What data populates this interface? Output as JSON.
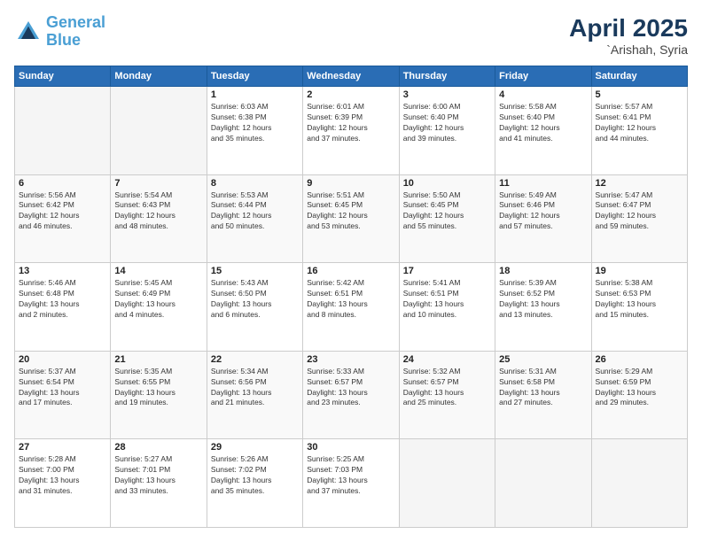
{
  "header": {
    "logo_line1": "General",
    "logo_line2": "Blue",
    "month_year": "April 2025",
    "location": "`Arishah, Syria"
  },
  "days_of_week": [
    "Sunday",
    "Monday",
    "Tuesday",
    "Wednesday",
    "Thursday",
    "Friday",
    "Saturday"
  ],
  "weeks": [
    [
      {
        "day": "",
        "info": ""
      },
      {
        "day": "",
        "info": ""
      },
      {
        "day": "1",
        "info": "Sunrise: 6:03 AM\nSunset: 6:38 PM\nDaylight: 12 hours\nand 35 minutes."
      },
      {
        "day": "2",
        "info": "Sunrise: 6:01 AM\nSunset: 6:39 PM\nDaylight: 12 hours\nand 37 minutes."
      },
      {
        "day": "3",
        "info": "Sunrise: 6:00 AM\nSunset: 6:40 PM\nDaylight: 12 hours\nand 39 minutes."
      },
      {
        "day": "4",
        "info": "Sunrise: 5:58 AM\nSunset: 6:40 PM\nDaylight: 12 hours\nand 41 minutes."
      },
      {
        "day": "5",
        "info": "Sunrise: 5:57 AM\nSunset: 6:41 PM\nDaylight: 12 hours\nand 44 minutes."
      }
    ],
    [
      {
        "day": "6",
        "info": "Sunrise: 5:56 AM\nSunset: 6:42 PM\nDaylight: 12 hours\nand 46 minutes."
      },
      {
        "day": "7",
        "info": "Sunrise: 5:54 AM\nSunset: 6:43 PM\nDaylight: 12 hours\nand 48 minutes."
      },
      {
        "day": "8",
        "info": "Sunrise: 5:53 AM\nSunset: 6:44 PM\nDaylight: 12 hours\nand 50 minutes."
      },
      {
        "day": "9",
        "info": "Sunrise: 5:51 AM\nSunset: 6:45 PM\nDaylight: 12 hours\nand 53 minutes."
      },
      {
        "day": "10",
        "info": "Sunrise: 5:50 AM\nSunset: 6:45 PM\nDaylight: 12 hours\nand 55 minutes."
      },
      {
        "day": "11",
        "info": "Sunrise: 5:49 AM\nSunset: 6:46 PM\nDaylight: 12 hours\nand 57 minutes."
      },
      {
        "day": "12",
        "info": "Sunrise: 5:47 AM\nSunset: 6:47 PM\nDaylight: 12 hours\nand 59 minutes."
      }
    ],
    [
      {
        "day": "13",
        "info": "Sunrise: 5:46 AM\nSunset: 6:48 PM\nDaylight: 13 hours\nand 2 minutes."
      },
      {
        "day": "14",
        "info": "Sunrise: 5:45 AM\nSunset: 6:49 PM\nDaylight: 13 hours\nand 4 minutes."
      },
      {
        "day": "15",
        "info": "Sunrise: 5:43 AM\nSunset: 6:50 PM\nDaylight: 13 hours\nand 6 minutes."
      },
      {
        "day": "16",
        "info": "Sunrise: 5:42 AM\nSunset: 6:51 PM\nDaylight: 13 hours\nand 8 minutes."
      },
      {
        "day": "17",
        "info": "Sunrise: 5:41 AM\nSunset: 6:51 PM\nDaylight: 13 hours\nand 10 minutes."
      },
      {
        "day": "18",
        "info": "Sunrise: 5:39 AM\nSunset: 6:52 PM\nDaylight: 13 hours\nand 13 minutes."
      },
      {
        "day": "19",
        "info": "Sunrise: 5:38 AM\nSunset: 6:53 PM\nDaylight: 13 hours\nand 15 minutes."
      }
    ],
    [
      {
        "day": "20",
        "info": "Sunrise: 5:37 AM\nSunset: 6:54 PM\nDaylight: 13 hours\nand 17 minutes."
      },
      {
        "day": "21",
        "info": "Sunrise: 5:35 AM\nSunset: 6:55 PM\nDaylight: 13 hours\nand 19 minutes."
      },
      {
        "day": "22",
        "info": "Sunrise: 5:34 AM\nSunset: 6:56 PM\nDaylight: 13 hours\nand 21 minutes."
      },
      {
        "day": "23",
        "info": "Sunrise: 5:33 AM\nSunset: 6:57 PM\nDaylight: 13 hours\nand 23 minutes."
      },
      {
        "day": "24",
        "info": "Sunrise: 5:32 AM\nSunset: 6:57 PM\nDaylight: 13 hours\nand 25 minutes."
      },
      {
        "day": "25",
        "info": "Sunrise: 5:31 AM\nSunset: 6:58 PM\nDaylight: 13 hours\nand 27 minutes."
      },
      {
        "day": "26",
        "info": "Sunrise: 5:29 AM\nSunset: 6:59 PM\nDaylight: 13 hours\nand 29 minutes."
      }
    ],
    [
      {
        "day": "27",
        "info": "Sunrise: 5:28 AM\nSunset: 7:00 PM\nDaylight: 13 hours\nand 31 minutes."
      },
      {
        "day": "28",
        "info": "Sunrise: 5:27 AM\nSunset: 7:01 PM\nDaylight: 13 hours\nand 33 minutes."
      },
      {
        "day": "29",
        "info": "Sunrise: 5:26 AM\nSunset: 7:02 PM\nDaylight: 13 hours\nand 35 minutes."
      },
      {
        "day": "30",
        "info": "Sunrise: 5:25 AM\nSunset: 7:03 PM\nDaylight: 13 hours\nand 37 minutes."
      },
      {
        "day": "",
        "info": ""
      },
      {
        "day": "",
        "info": ""
      },
      {
        "day": "",
        "info": ""
      }
    ]
  ]
}
